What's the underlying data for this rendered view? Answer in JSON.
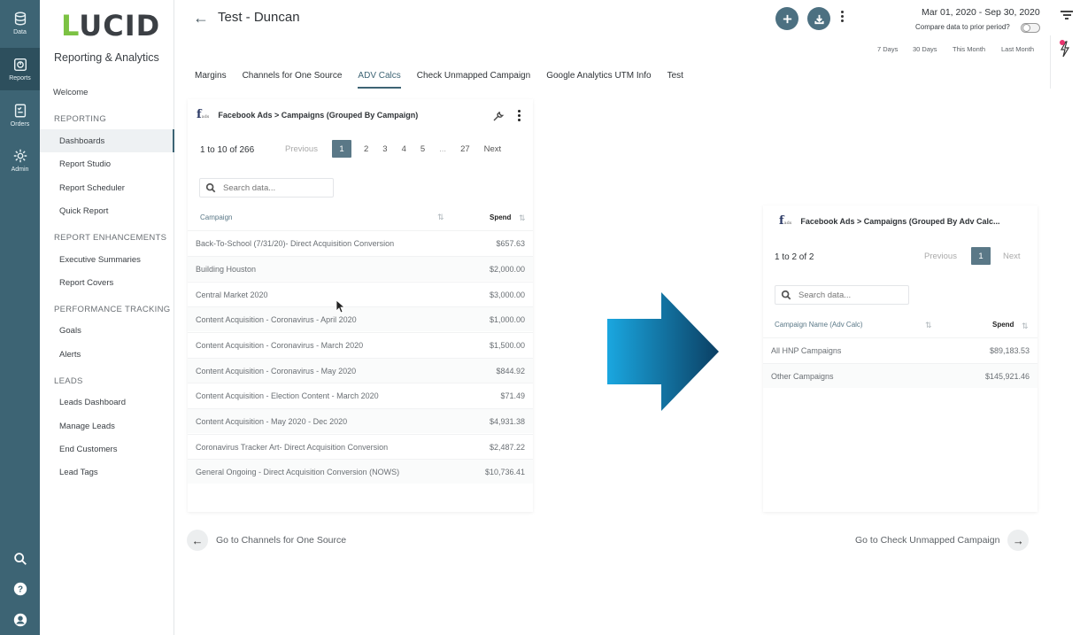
{
  "rail": {
    "items": [
      {
        "label": "Data",
        "icon": "database-icon"
      },
      {
        "label": "Reports",
        "icon": "reports-icon"
      },
      {
        "label": "Orders",
        "icon": "orders-icon"
      },
      {
        "label": "Admin",
        "icon": "gear-icon"
      }
    ],
    "bottom": [
      "search-icon",
      "help-icon",
      "user-icon"
    ]
  },
  "sidebar": {
    "logo": "LUCID",
    "title": "Reporting & Analytics",
    "welcome": "Welcome",
    "sections": [
      {
        "heading": "REPORTING",
        "items": [
          "Dashboards",
          "Report Studio",
          "Report Scheduler",
          "Quick Report"
        ]
      },
      {
        "heading": "REPORT ENHANCEMENTS",
        "items": [
          "Executive Summaries",
          "Report Covers"
        ]
      },
      {
        "heading": "PERFORMANCE TRACKING",
        "items": [
          "Goals",
          "Alerts"
        ]
      },
      {
        "heading": "LEADS",
        "items": [
          "Leads Dashboard",
          "Manage Leads",
          "End Customers",
          "Lead Tags"
        ]
      }
    ],
    "active_item": "Dashboards"
  },
  "header": {
    "title": "Test - Duncan",
    "date_range": "Mar 01, 2020 - Sep 30, 2020",
    "compare_label": "Compare data to prior period?",
    "quick_dates": [
      "7 Days",
      "30 Days",
      "This Month",
      "Last Month"
    ]
  },
  "tabs": [
    {
      "label": "Margins"
    },
    {
      "label": "Channels for One Source"
    },
    {
      "label": "ADV Calcs",
      "active": true
    },
    {
      "label": "Check Unmapped Campaign"
    },
    {
      "label": "Google Analytics UTM Info"
    },
    {
      "label": "Test"
    }
  ],
  "widget_left": {
    "title": "Facebook Ads > Campaigns (Grouped By Campaign)",
    "range": "1 to 10 of 266",
    "pager": {
      "previous": "Previous",
      "pages": [
        "1",
        "2",
        "3",
        "4",
        "5",
        "...",
        "27"
      ],
      "next": "Next"
    },
    "search_placeholder": "Search data...",
    "columns": [
      "Campaign",
      "Spend"
    ],
    "rows": [
      [
        "Back-To-School (7/31/20)- Direct Acquisition Conversion",
        "$657.63"
      ],
      [
        "Building Houston",
        "$2,000.00"
      ],
      [
        "Central Market 2020",
        "$3,000.00"
      ],
      [
        "Content Acquisition - Coronavirus - April 2020",
        "$1,000.00"
      ],
      [
        "Content Acquisition - Coronavirus - March 2020",
        "$1,500.00"
      ],
      [
        "Content Acquisition - Coronavirus - May 2020",
        "$844.92"
      ],
      [
        "Content Acquisition - Election Content - March 2020",
        "$71.49"
      ],
      [
        "Content Acquisition - May 2020 - Dec 2020",
        "$4,931.38"
      ],
      [
        "Coronavirus Tracker Art- Direct Acquisition Conversion",
        "$2,487.22"
      ],
      [
        "General Ongoing - Direct Acquisition Conversion (NOWS)",
        "$10,736.41"
      ]
    ]
  },
  "widget_right": {
    "title": "Facebook Ads > Campaigns (Grouped By Adv Calc...",
    "range": "1 to 2 of 2",
    "pager": {
      "previous": "Previous",
      "pages": [
        "1"
      ],
      "next": "Next"
    },
    "search_placeholder": "Search data...",
    "columns": [
      "Campaign Name (Adv Calc)",
      "Spend"
    ],
    "rows": [
      [
        "All HNP Campaigns",
        "$89,183.53"
      ],
      [
        "Other Campaigns",
        "$145,921.46"
      ]
    ]
  },
  "footer": {
    "prev_label": "Go to Channels for One Source",
    "next_label": "Go to Check Unmapped Campaign"
  },
  "colors": {
    "rail": "#3d6474",
    "accent": "#5a7887",
    "arrow_start": "#1aa7e0",
    "arrow_end": "#0b3f63"
  }
}
